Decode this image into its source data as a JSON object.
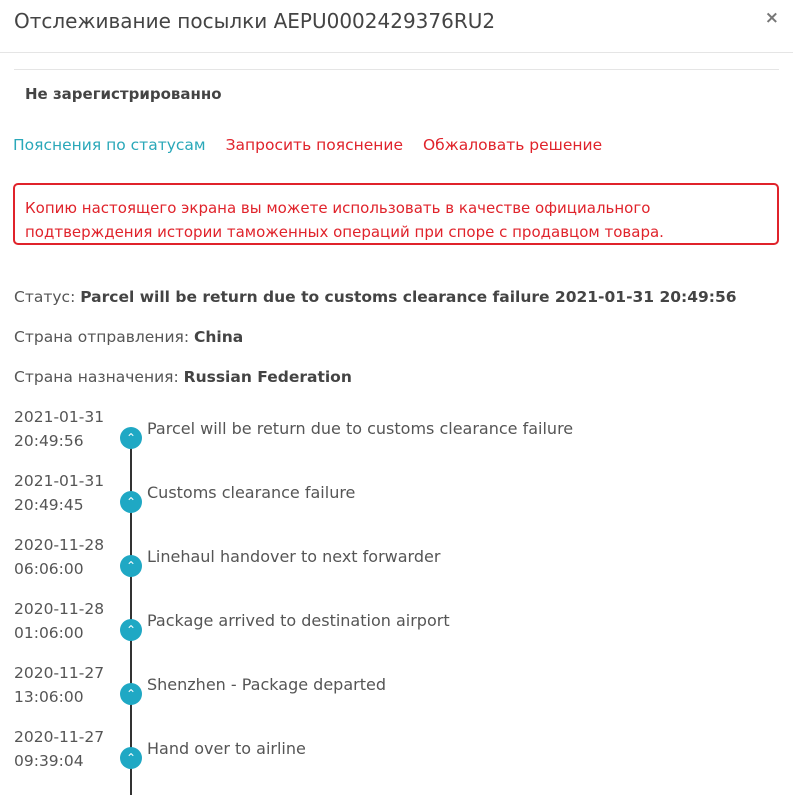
{
  "dialog": {
    "title": "Отслеживание посылки AEPU0002429376RU2",
    "close_label": "×"
  },
  "registration_status": "Не зарегистрированно",
  "links": {
    "explain_statuses": "Пояснения по статусам",
    "request_explanation": "Запросить пояснение",
    "appeal_decision": "Обжаловать решение"
  },
  "alert": {
    "text": "Копию настоящего экрана вы можете использовать в качестве официального подтверждения истории таможенных операций при споре с продавцом товара."
  },
  "info": {
    "status_label": "Статус: ",
    "status_value": "Parcel will be return due to customs clearance failure 2021-01-31 20:49:56",
    "origin_label": "Страна отправления: ",
    "origin_value": "China",
    "destination_label": "Страна назначения: ",
    "destination_value": "Russian Federation"
  },
  "colors": {
    "accent_teal": "#1fa8c4",
    "alert_red": "#e0232b"
  },
  "events": [
    {
      "date": "2021-01-31",
      "time": "20:49:56",
      "description": "Parcel will be return due to customs clearance failure",
      "icon": "chevron-up-icon"
    },
    {
      "date": "2021-01-31",
      "time": "20:49:45",
      "description": "Customs clearance failure",
      "icon": "chevron-up-icon"
    },
    {
      "date": "2020-11-28",
      "time": "06:06:00",
      "description": "Linehaul handover to next forwarder",
      "icon": "chevron-up-icon"
    },
    {
      "date": "2020-11-28",
      "time": "01:06:00",
      "description": "Package arrived to destination airport",
      "icon": "chevron-up-icon"
    },
    {
      "date": "2020-11-27",
      "time": "13:06:00",
      "description": "Shenzhen - Package departed",
      "icon": "chevron-up-icon"
    },
    {
      "date": "2020-11-27",
      "time": "09:39:04",
      "description": "Hand over to airline",
      "icon": "chevron-up-icon"
    }
  ]
}
